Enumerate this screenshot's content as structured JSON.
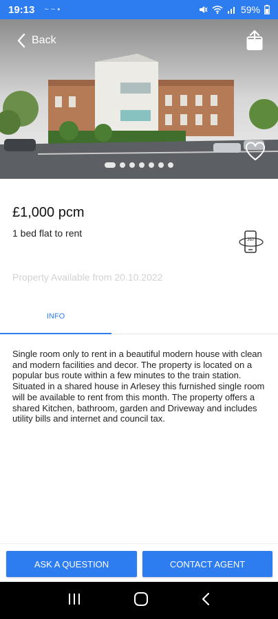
{
  "status_bar": {
    "time": "19:13",
    "notif_icons": "~ ~ •",
    "battery": "59%"
  },
  "hero": {
    "back_label": "Back",
    "icons": [
      "chevron-left-icon",
      "share-icon",
      "heart-icon"
    ],
    "image_description_icon": "property-photo",
    "carousel_dots": 7
  },
  "listing": {
    "price": "£1,000 pcm",
    "property_type": "1 bed flat to rent",
    "vr_icon": "360-vr-phone-icon",
    "available": "Property Available from 20.10.2022"
  },
  "tabs": {
    "info": "INFO"
  },
  "description": "Single room only to rent in a beautiful modern house with clean and modern facilities and decor. The property is located on a popular bus route within a few minutes to the train station. Situated in a shared house in Arlesey this furnished single room will be available to rent from this month. The property offers a shared Kitchen, bathroom, garden and Driveway and includes utility bills and internet and council tax.",
  "actions": {
    "ask": "ASK A QUESTION",
    "contact": "CONTACT AGENT"
  },
  "nav": {
    "icons": [
      "recent-apps-icon",
      "home-icon",
      "back-icon"
    ]
  },
  "colors": {
    "accent": "#2d7cf0",
    "muted_text": "#d2d2d2"
  }
}
